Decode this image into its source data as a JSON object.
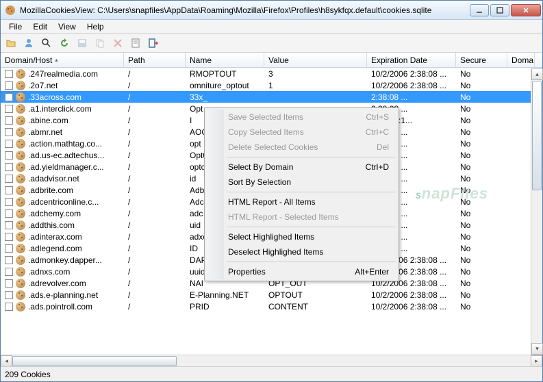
{
  "titlebar": {
    "text": "MozillaCookiesView: C:\\Users\\snapfiles\\AppData\\Roaming\\Mozilla\\Firefox\\Profiles\\h8sykfqx.default\\cookies.sqlite"
  },
  "menubar": [
    "File",
    "Edit",
    "View",
    "Help"
  ],
  "columns": {
    "host": "Domain/Host",
    "path": "Path",
    "name": "Name",
    "value": "Value",
    "exp": "Expiration Date",
    "secure": "Secure",
    "dom2": "Doma"
  },
  "rows": [
    {
      "host": ".247realmedia.com",
      "path": "/",
      "name": "RMOPTOUT",
      "value": "3",
      "exp": "10/2/2006 2:38:08 ...",
      "secure": "No",
      "selected": false
    },
    {
      "host": ".2o7.net",
      "path": "/",
      "name": "omniture_optout",
      "value": "1",
      "exp": "10/2/2006 2:38:08 ...",
      "secure": "No",
      "selected": false
    },
    {
      "host": ".33across.com",
      "path": "/",
      "name": "33x_",
      "value": "",
      "exp": "2:38:08 ...",
      "secure": "No",
      "selected": true
    },
    {
      "host": ".a1.interclick.com",
      "path": "/",
      "name": "Opt",
      "value": "",
      "exp": "2:38:08 ...",
      "secure": "No",
      "selected": false
    },
    {
      "host": ".abine.com",
      "path": "/",
      "name": "I",
      "value": "",
      "exp": "2 12:50:1...",
      "secure": "No",
      "selected": false
    },
    {
      "host": ".abmr.net",
      "path": "/",
      "name": "AOC",
      "value": "",
      "exp": "2:38:08 ...",
      "secure": "No",
      "selected": false
    },
    {
      "host": ".action.mathtag.co...",
      "path": "/",
      "name": "opt",
      "value": "",
      "exp": "2:38:08 ...",
      "secure": "No",
      "selected": false
    },
    {
      "host": ".ad.us-ec.adtechus...",
      "path": "/",
      "name": "Opt0",
      "value": "",
      "exp": "2:38:08 ...",
      "secure": "No",
      "selected": false
    },
    {
      "host": ".ad.yieldmanager.c...",
      "path": "/",
      "name": "optc",
      "value": "",
      "exp": "2:38:08 ...",
      "secure": "No",
      "selected": false
    },
    {
      "host": ".adadvisor.net",
      "path": "/",
      "name": "id",
      "value": "",
      "exp": "2:38:08 ...",
      "secure": "No",
      "selected": false
    },
    {
      "host": ".adbrite.com",
      "path": "/",
      "name": "Adb",
      "value": "",
      "exp": "2:38:08 ...",
      "secure": "No",
      "selected": false
    },
    {
      "host": ".adcentriconline.c...",
      "path": "/",
      "name": "Adc",
      "value": "",
      "exp": "2:38:08 ...",
      "secure": "No",
      "selected": false
    },
    {
      "host": ".adchemy.com",
      "path": "/",
      "name": "adc",
      "value": "",
      "exp": "2:38:08 ...",
      "secure": "No",
      "selected": false
    },
    {
      "host": ".addthis.com",
      "path": "/",
      "name": "uid",
      "value": "",
      "exp": "2:38:08 ...",
      "secure": "No",
      "selected": false
    },
    {
      "host": ".adinterax.com",
      "path": "/",
      "name": "adxc",
      "value": "",
      "exp": "2:38:08 ...",
      "secure": "No",
      "selected": false
    },
    {
      "host": ".adlegend.com",
      "path": "/",
      "name": "ID",
      "value": "",
      "exp": "2:38:08 ...",
      "secure": "No",
      "selected": false
    },
    {
      "host": ".admonkey.dapper...",
      "path": "/",
      "name": "DAPPEROPTOUT2",
      "value": "OPT-OUT",
      "exp": "10/2/2006 2:38:08 ...",
      "secure": "No",
      "selected": false
    },
    {
      "host": ".adnxs.com",
      "path": "/",
      "name": "uuid2",
      "value": "-1",
      "exp": "10/2/2006 2:38:08 ...",
      "secure": "No",
      "selected": false
    },
    {
      "host": ".adrevolver.com",
      "path": "/",
      "name": "NAI",
      "value": "OPT_OUT",
      "exp": "10/2/2006 2:38:08 ...",
      "secure": "No",
      "selected": false
    },
    {
      "host": ".ads.e-planning.net",
      "path": "/",
      "name": "E-Planning.NET",
      "value": "OPTOUT",
      "exp": "10/2/2006 2:38:08 ...",
      "secure": "No",
      "selected": false
    },
    {
      "host": ".ads.pointroll.com",
      "path": "/",
      "name": "PRID",
      "value": "CONTENT",
      "exp": "10/2/2006 2:38:08 ...",
      "secure": "No",
      "selected": false
    }
  ],
  "context_menu": [
    {
      "label": "Save Selected Items",
      "shortcut": "Ctrl+S",
      "disabled": true
    },
    {
      "label": "Copy Selected Items",
      "shortcut": "Ctrl+C",
      "disabled": true
    },
    {
      "label": "Delete Selected Cookies",
      "shortcut": "Del",
      "disabled": true
    },
    {
      "sep": true
    },
    {
      "label": "Select By Domain",
      "shortcut": "Ctrl+D",
      "disabled": false
    },
    {
      "label": "Sort By Selection",
      "shortcut": "",
      "disabled": false
    },
    {
      "sep": true
    },
    {
      "label": "HTML Report - All Items",
      "shortcut": "",
      "disabled": false
    },
    {
      "label": "HTML Report - Selected Items",
      "shortcut": "",
      "disabled": true
    },
    {
      "sep": true
    },
    {
      "label": "Select Highlighed Items",
      "shortcut": "",
      "disabled": false
    },
    {
      "label": "Deselect Highlighed Items",
      "shortcut": "",
      "disabled": false
    },
    {
      "sep": true
    },
    {
      "label": "Properties",
      "shortcut": "Alt+Enter",
      "disabled": false
    }
  ],
  "statusbar": {
    "text": "209 Cookies"
  },
  "watermark": "SnapFiles"
}
